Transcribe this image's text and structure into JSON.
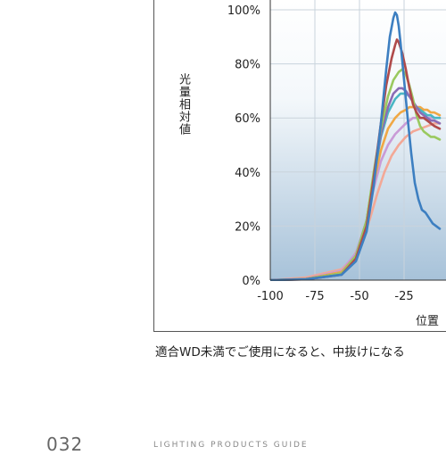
{
  "chart_data": {
    "type": "line",
    "ylabel": "光量相対値",
    "xlabel": "位置",
    "x_ticks": [
      "-100",
      "-75",
      "-50",
      "-25"
    ],
    "y_ticks": [
      "0%",
      "20%",
      "40%",
      "60%",
      "80%",
      "100%"
    ],
    "xlim": [
      -100,
      -5
    ],
    "ylim": [
      0,
      100
    ],
    "grid": true,
    "series": [
      {
        "color": "#3d7fc1",
        "x": [
          -100,
          -80,
          -60,
          -52,
          -46,
          -42,
          -38,
          -35,
          -33,
          -31,
          -30,
          -29,
          -28,
          -27,
          -25,
          -23,
          -21,
          -19,
          -17,
          -15,
          -13,
          -11,
          -9,
          -7,
          -5
        ],
        "y": [
          0,
          0.3,
          2,
          7,
          18,
          35,
          58,
          78,
          90,
          97,
          99,
          98,
          94,
          88,
          74,
          60,
          47,
          36,
          30,
          26,
          25,
          23,
          21,
          20,
          19
        ]
      },
      {
        "color": "#b04a4a",
        "x": [
          -100,
          -80,
          -60,
          -52,
          -46,
          -42,
          -38,
          -35,
          -32,
          -30,
          -29,
          -28,
          -26,
          -24,
          -22,
          -20,
          -18,
          -16,
          -14,
          -12,
          -10,
          -8,
          -5
        ],
        "y": [
          0,
          0.3,
          2,
          8,
          20,
          38,
          58,
          72,
          82,
          87,
          89,
          88,
          84,
          78,
          71,
          65,
          62,
          60,
          60,
          59,
          58,
          57,
          56
        ]
      },
      {
        "color": "#9ac95f",
        "x": [
          -100,
          -80,
          -60,
          -52,
          -46,
          -42,
          -38,
          -34,
          -31,
          -28,
          -26,
          -24,
          -22,
          -20,
          -18,
          -16,
          -14,
          -12,
          -10,
          -8,
          -5
        ],
        "y": [
          0,
          0.4,
          2.5,
          9,
          22,
          40,
          56,
          68,
          74,
          77,
          78,
          76,
          72,
          67,
          61,
          57,
          55,
          54,
          53,
          53,
          52
        ]
      },
      {
        "color": "#8a6cb5",
        "x": [
          -100,
          -80,
          -60,
          -52,
          -46,
          -42,
          -38,
          -34,
          -31,
          -28,
          -26,
          -24,
          -22,
          -20,
          -18,
          -16,
          -14,
          -12,
          -10,
          -8,
          -5
        ],
        "y": [
          0,
          0.4,
          2.5,
          9,
          22,
          39,
          54,
          64,
          69,
          71,
          71,
          70,
          68,
          66,
          64,
          62,
          61,
          60,
          59,
          59,
          58
        ]
      },
      {
        "color": "#4ab6c4",
        "x": [
          -100,
          -80,
          -60,
          -52,
          -46,
          -42,
          -38,
          -34,
          -30,
          -27,
          -24,
          -22,
          -20,
          -18,
          -16,
          -14,
          -12,
          -10,
          -8,
          -5
        ],
        "y": [
          0,
          0.4,
          2.5,
          9,
          22,
          38,
          53,
          62,
          67,
          69,
          69,
          68,
          66,
          64,
          63,
          62,
          61,
          61,
          60,
          60
        ]
      },
      {
        "color": "#f0a845",
        "x": [
          -100,
          -80,
          -60,
          -52,
          -46,
          -42,
          -38,
          -34,
          -30,
          -27,
          -24,
          -22,
          -20,
          -18,
          -16,
          -14,
          -12,
          -10,
          -8,
          -5
        ],
        "y": [
          0,
          0.5,
          3,
          9,
          22,
          36,
          48,
          56,
          60,
          62,
          63,
          64,
          64,
          64,
          64,
          63,
          63,
          62,
          62,
          61
        ]
      },
      {
        "color": "#c99bd6",
        "x": [
          -100,
          -80,
          -60,
          -52,
          -46,
          -42,
          -38,
          -34,
          -30,
          -27,
          -24,
          -22,
          -20,
          -18,
          -16,
          -14,
          -12,
          -10,
          -8,
          -5
        ],
        "y": [
          0,
          0.6,
          3.5,
          10,
          22,
          34,
          44,
          50,
          54,
          56,
          58,
          59,
          60,
          60,
          60,
          60,
          60,
          60,
          60,
          60
        ]
      },
      {
        "color": "#f3a896",
        "x": [
          -100,
          -80,
          -60,
          -54,
          -48,
          -44,
          -40,
          -36,
          -32,
          -28,
          -24,
          -20,
          -16,
          -12,
          -8,
          -5
        ],
        "y": [
          0,
          1,
          4,
          8,
          15,
          23,
          32,
          40,
          46,
          50,
          53,
          55,
          56,
          57,
          58,
          58
        ]
      }
    ]
  },
  "caption": "適合WD未満でご使用になると、中抜けになる",
  "page_number": "032",
  "footer_text": "LIGHTING PRODUCTS GUIDE"
}
